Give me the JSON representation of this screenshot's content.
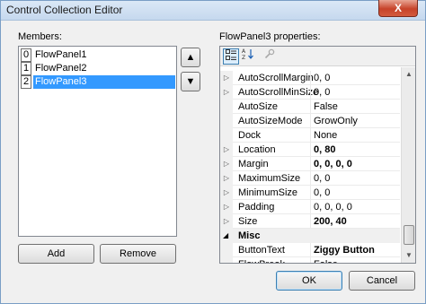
{
  "window": {
    "title": "Control Collection Editor",
    "close_glyph": "X"
  },
  "members": {
    "label": "Members:",
    "items": [
      {
        "index": "0",
        "name": "FlowPanel1",
        "selected": false
      },
      {
        "index": "1",
        "name": "FlowPanel2",
        "selected": false
      },
      {
        "index": "2",
        "name": "FlowPanel3",
        "selected": true
      }
    ],
    "move_up_glyph": "▲",
    "move_down_glyph": "▼",
    "add_label": "Add",
    "remove_label": "Remove"
  },
  "properties": {
    "label": "FlowPanel3 properties:",
    "toolbar": {
      "categorized_icon": "categorized-icon",
      "alphabetical_icon": "alphabetical-icon",
      "property_pages_icon": "property-pages-icon"
    },
    "rows": [
      {
        "type": "prop",
        "expand": "▷",
        "name": "AutoScrollMargin",
        "value": "0, 0",
        "bold": false
      },
      {
        "type": "prop",
        "expand": "▷",
        "name": "AutoScrollMinSize",
        "value": "0, 0",
        "bold": false
      },
      {
        "type": "prop",
        "expand": "",
        "name": "AutoSize",
        "value": "False",
        "bold": false
      },
      {
        "type": "prop",
        "expand": "",
        "name": "AutoSizeMode",
        "value": "GrowOnly",
        "bold": false
      },
      {
        "type": "prop",
        "expand": "",
        "name": "Dock",
        "value": "None",
        "bold": false
      },
      {
        "type": "prop",
        "expand": "▷",
        "name": "Location",
        "value": "0, 80",
        "bold": true
      },
      {
        "type": "prop",
        "expand": "▷",
        "name": "Margin",
        "value": "0, 0, 0, 0",
        "bold": true
      },
      {
        "type": "prop",
        "expand": "▷",
        "name": "MaximumSize",
        "value": "0, 0",
        "bold": false
      },
      {
        "type": "prop",
        "expand": "▷",
        "name": "MinimumSize",
        "value": "0, 0",
        "bold": false
      },
      {
        "type": "prop",
        "expand": "▷",
        "name": "Padding",
        "value": "0, 0, 0, 0",
        "bold": false
      },
      {
        "type": "prop",
        "expand": "▷",
        "name": "Size",
        "value": "200, 40",
        "bold": true
      },
      {
        "type": "category",
        "expand": "◢",
        "name": "Misc"
      },
      {
        "type": "prop",
        "expand": "",
        "name": "ButtonText",
        "value": "Ziggy Button",
        "bold": true
      },
      {
        "type": "prop",
        "expand": "",
        "name": "FlowBreak",
        "value": "False",
        "bold": false
      }
    ]
  },
  "footer": {
    "ok_label": "OK",
    "cancel_label": "Cancel"
  }
}
